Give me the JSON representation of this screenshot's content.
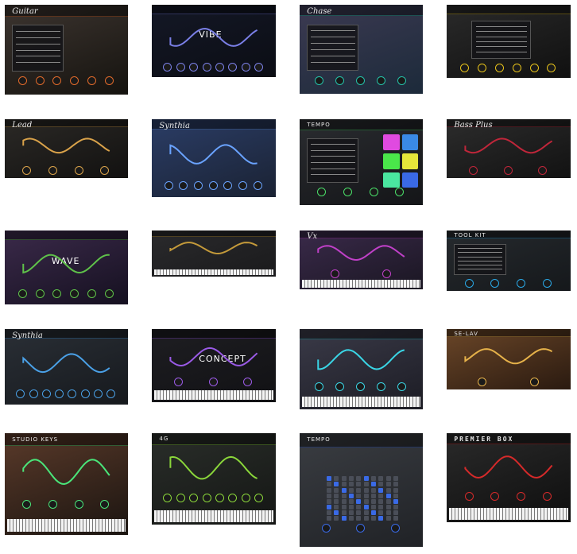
{
  "gallery": {
    "thumbnails": [
      {
        "id": "guitar-plugin",
        "text": "Guitar",
        "style": "script",
        "bg": [
          "#3d3530",
          "#15130f"
        ],
        "accent": "#e06a2a",
        "piano": false,
        "list": true,
        "knobs": 6
      },
      {
        "id": "vibe-plugin",
        "text": "VIBE",
        "style": "plain",
        "bg": [
          "#141826",
          "#0b0d14"
        ],
        "accent": "#7a7fe6",
        "piano": false,
        "list": false,
        "knobs": 8
      },
      {
        "id": "chase-plugin",
        "text": "Chase",
        "style": "script",
        "bg": [
          "#3c3a52",
          "#1c2a3a"
        ],
        "accent": "#24c0a8",
        "piano": false,
        "list": true,
        "knobs": 5
      },
      {
        "id": "gold-rack-plugin",
        "text": "",
        "style": "plain",
        "bg": [
          "#2a2a2a",
          "#101010"
        ],
        "accent": "#e6c21a",
        "piano": false,
        "list": true,
        "knobs": 6
      },
      {
        "id": "acoustic-guitar-plugin",
        "text": "Lead",
        "style": "script",
        "bg": [
          "#2b2926",
          "#121110"
        ],
        "accent": "#d9a24a",
        "piano": false,
        "list": false,
        "knobs": 4
      },
      {
        "id": "synth-wave-plugin",
        "text": "Synthia",
        "style": "script",
        "bg": [
          "#2b3d66",
          "#1a2233"
        ],
        "accent": "#6aa3ff",
        "piano": false,
        "list": false,
        "knobs": 7
      },
      {
        "id": "tempo-pads-plugin",
        "text": "TEMPO",
        "style": "plain",
        "bg": [
          "#2a2c30",
          "#141518"
        ],
        "accent": "#4adf6a",
        "piano": false,
        "list": true,
        "knobs": 4
      },
      {
        "id": "bass-plugin",
        "text": "Bass Plus",
        "style": "script",
        "bg": [
          "#2c2c2c",
          "#121212"
        ],
        "accent": "#c0263a",
        "piano": false,
        "list": false,
        "knobs": 3
      },
      {
        "id": "wave-plugin",
        "text": "WAVE",
        "style": "plain",
        "bg": [
          "#3b2a4a",
          "#151020"
        ],
        "accent": "#5fc24a",
        "piano": false,
        "list": false,
        "knobs": 6
      },
      {
        "id": "concept-keys-plugin",
        "text": "",
        "style": "plain",
        "bg": [
          "#2a2a2c",
          "#1a1a1c"
        ],
        "accent": "#c49a3a",
        "piano": true,
        "list": false,
        "knobs": 0
      },
      {
        "id": "vox-plugin",
        "text": "Vx",
        "style": "script",
        "bg": [
          "#3a2a4a",
          "#1a1622"
        ],
        "accent": "#c040c8",
        "piano": true,
        "list": false,
        "knobs": 2
      },
      {
        "id": "toolkit-plugin",
        "text": "TOOL KIT",
        "style": "plain",
        "bg": [
          "#262a2e",
          "#15181b"
        ],
        "accent": "#2aa8e6",
        "piano": false,
        "list": true,
        "knobs": 4
      },
      {
        "id": "synthia-fx-plugin",
        "text": "Synthia",
        "style": "script",
        "bg": [
          "#2a2f36",
          "#16191d"
        ],
        "accent": "#4aa0e6",
        "piano": false,
        "list": false,
        "knobs": 8
      },
      {
        "id": "concept-plugin",
        "text": "CONCEPT",
        "style": "plain",
        "bg": [
          "#1e1e22",
          "#111114"
        ],
        "accent": "#9a5ae6",
        "piano": true,
        "list": false,
        "knobs": 3
      },
      {
        "id": "waveform-editor-plugin",
        "text": "",
        "style": "plain",
        "bg": [
          "#3a3a48",
          "#1c1c24"
        ],
        "accent": "#3ad6e6",
        "piano": true,
        "list": false,
        "knobs": 5
      },
      {
        "id": "retro-fx-plugin",
        "text": "SE-LAV",
        "style": "plain",
        "bg": [
          "#6a4628",
          "#2a1a10"
        ],
        "accent": "#e6b24a",
        "piano": false,
        "list": false,
        "knobs": 2
      },
      {
        "id": "studio-keys-plugin",
        "text": "STUDIO KEYS",
        "style": "plain",
        "bg": [
          "#5a3a2a",
          "#1a1410"
        ],
        "accent": "#4ae67a",
        "piano": true,
        "list": false,
        "knobs": 4
      },
      {
        "id": "4g-wavetable-plugin",
        "text": "4G",
        "style": "plain",
        "bg": [
          "#2a2e2a",
          "#141614"
        ],
        "accent": "#8ad63a",
        "piano": true,
        "list": false,
        "knobs": 8
      },
      {
        "id": "tempo-grid-plugin",
        "text": "TEMPO",
        "style": "plain",
        "bg": [
          "#3a3d42",
          "#202226"
        ],
        "accent": "#3a6ae6",
        "piano": false,
        "list": false,
        "knobs": 3
      },
      {
        "id": "premier-box-plugin",
        "text": "PREMIER BOX",
        "style": "blk",
        "bg": [
          "#2a2a2a",
          "#0e0e0e"
        ],
        "accent": "#d62a2a",
        "piano": true,
        "list": false,
        "knobs": 4
      }
    ]
  }
}
